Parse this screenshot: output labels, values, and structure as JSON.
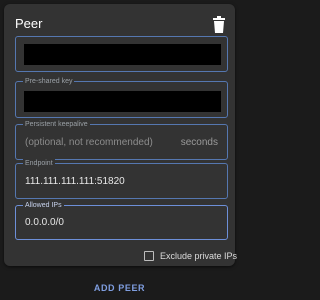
{
  "peer": {
    "title": "Peer",
    "delete_icon": "trash-icon"
  },
  "fields": {
    "public_key": {
      "label": "",
      "value": ""
    },
    "preshared_key": {
      "label": "Pre-shared key",
      "value": ""
    },
    "persistent_keepalive": {
      "label": "Persistent keepalive",
      "placeholder": "(optional, not recommended)",
      "suffix": "seconds"
    },
    "endpoint": {
      "label": "Endpoint",
      "value": "111.111.111.111:51820"
    },
    "allowed_ips": {
      "label": "Allowed IPs",
      "value": "0.0.0.0/0"
    }
  },
  "exclude_private_ips": {
    "label": "Exclude private IPs",
    "checked": false
  },
  "actions": {
    "add_peer_label": "ADD PEER"
  },
  "colors": {
    "accent": "#7f9ee0",
    "field_border": "#5577b0",
    "card_background": "#333333",
    "page_background": "#1b1b1b"
  }
}
